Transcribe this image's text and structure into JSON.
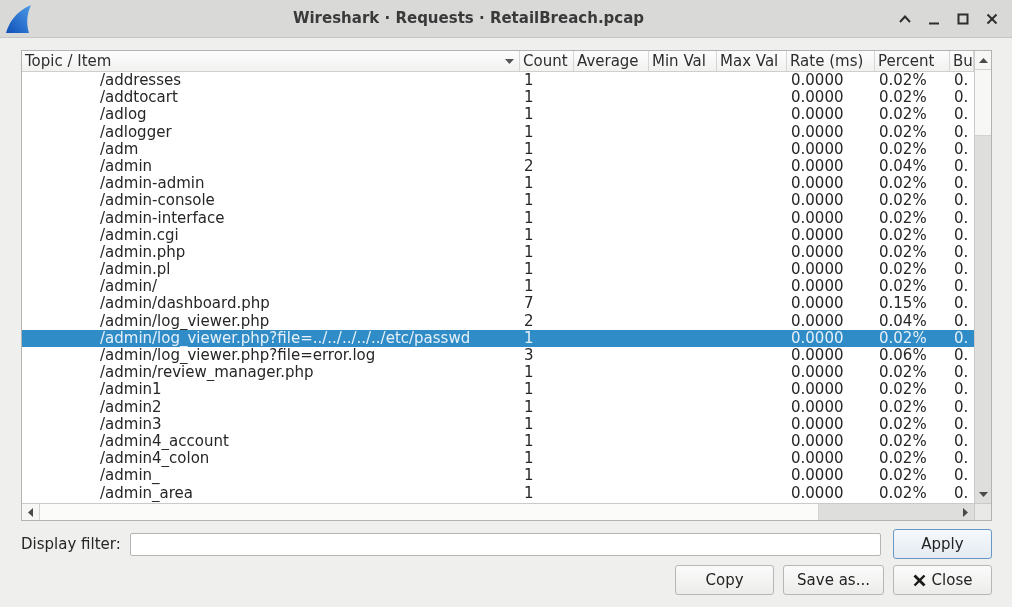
{
  "window": {
    "title": "Wireshark · Requests · RetailBreach.pcap"
  },
  "table": {
    "columns": [
      {
        "label": "Topic / Item",
        "sorted": true
      },
      {
        "label": "Count",
        "sorted": false
      },
      {
        "label": "Average",
        "sorted": false
      },
      {
        "label": "Min Val",
        "sorted": false
      },
      {
        "label": "Max Val",
        "sorted": false
      },
      {
        "label": "Rate (ms)",
        "sorted": false
      },
      {
        "label": "Percent",
        "sorted": false
      },
      {
        "label": "Bu",
        "sorted": false
      }
    ],
    "rows": [
      {
        "item": "/addresses",
        "count": "1",
        "rate_ms": "0.0000",
        "percent": "0.02%",
        "column_8": "0.",
        "selected": false
      },
      {
        "item": "/addtocart",
        "count": "1",
        "rate_ms": "0.0000",
        "percent": "0.02%",
        "column_8": "0.",
        "selected": false
      },
      {
        "item": "/adlog",
        "count": "1",
        "rate_ms": "0.0000",
        "percent": "0.02%",
        "column_8": "0.",
        "selected": false
      },
      {
        "item": "/adlogger",
        "count": "1",
        "rate_ms": "0.0000",
        "percent": "0.02%",
        "column_8": "0.",
        "selected": false
      },
      {
        "item": "/adm",
        "count": "1",
        "rate_ms": "0.0000",
        "percent": "0.02%",
        "column_8": "0.",
        "selected": false
      },
      {
        "item": "/admin",
        "count": "2",
        "rate_ms": "0.0000",
        "percent": "0.04%",
        "column_8": "0.",
        "selected": false
      },
      {
        "item": "/admin-admin",
        "count": "1",
        "rate_ms": "0.0000",
        "percent": "0.02%",
        "column_8": "0.",
        "selected": false
      },
      {
        "item": "/admin-console",
        "count": "1",
        "rate_ms": "0.0000",
        "percent": "0.02%",
        "column_8": "0.",
        "selected": false
      },
      {
        "item": "/admin-interface",
        "count": "1",
        "rate_ms": "0.0000",
        "percent": "0.02%",
        "column_8": "0.",
        "selected": false
      },
      {
        "item": "/admin.cgi",
        "count": "1",
        "rate_ms": "0.0000",
        "percent": "0.02%",
        "column_8": "0.",
        "selected": false
      },
      {
        "item": "/admin.php",
        "count": "1",
        "rate_ms": "0.0000",
        "percent": "0.02%",
        "column_8": "0.",
        "selected": false
      },
      {
        "item": "/admin.pl",
        "count": "1",
        "rate_ms": "0.0000",
        "percent": "0.02%",
        "column_8": "0.",
        "selected": false
      },
      {
        "item": "/admin/",
        "count": "1",
        "rate_ms": "0.0000",
        "percent": "0.02%",
        "column_8": "0.",
        "selected": false
      },
      {
        "item": "/admin/dashboard.php",
        "count": "7",
        "rate_ms": "0.0000",
        "percent": "0.15%",
        "column_8": "0.",
        "selected": false
      },
      {
        "item": "/admin/log_viewer.php",
        "count": "2",
        "rate_ms": "0.0000",
        "percent": "0.04%",
        "column_8": "0.",
        "selected": false
      },
      {
        "item": "/admin/log_viewer.php?file=../../../../../etc/passwd",
        "count": "1",
        "rate_ms": "0.0000",
        "percent": "0.02%",
        "column_8": "0.",
        "selected": true
      },
      {
        "item": "/admin/log_viewer.php?file=error.log",
        "count": "3",
        "rate_ms": "0.0000",
        "percent": "0.06%",
        "column_8": "0.",
        "selected": false
      },
      {
        "item": "/admin/review_manager.php",
        "count": "1",
        "rate_ms": "0.0000",
        "percent": "0.02%",
        "column_8": "0.",
        "selected": false
      },
      {
        "item": "/admin1",
        "count": "1",
        "rate_ms": "0.0000",
        "percent": "0.02%",
        "column_8": "0.",
        "selected": false
      },
      {
        "item": "/admin2",
        "count": "1",
        "rate_ms": "0.0000",
        "percent": "0.02%",
        "column_8": "0.",
        "selected": false
      },
      {
        "item": "/admin3",
        "count": "1",
        "rate_ms": "0.0000",
        "percent": "0.02%",
        "column_8": "0.",
        "selected": false
      },
      {
        "item": "/admin4_account",
        "count": "1",
        "rate_ms": "0.0000",
        "percent": "0.02%",
        "column_8": "0.",
        "selected": false
      },
      {
        "item": "/admin4_colon",
        "count": "1",
        "rate_ms": "0.0000",
        "percent": "0.02%",
        "column_8": "0.",
        "selected": false
      },
      {
        "item": "/admin_",
        "count": "1",
        "rate_ms": "0.0000",
        "percent": "0.02%",
        "column_8": "0.",
        "selected": false
      },
      {
        "item": "/admin_area",
        "count": "1",
        "rate_ms": "0.0000",
        "percent": "0.02%",
        "column_8": "0.",
        "selected": false
      }
    ]
  },
  "filter": {
    "label": "Display filter:",
    "apply": {
      "label": "Apply",
      "default": true
    }
  },
  "buttons": [
    {
      "label": "Copy",
      "kind": "plain",
      "default": false
    },
    {
      "label": "Save as...",
      "kind": "plain",
      "default": false
    },
    {
      "label": "Close",
      "kind": "close",
      "default": false
    }
  ]
}
